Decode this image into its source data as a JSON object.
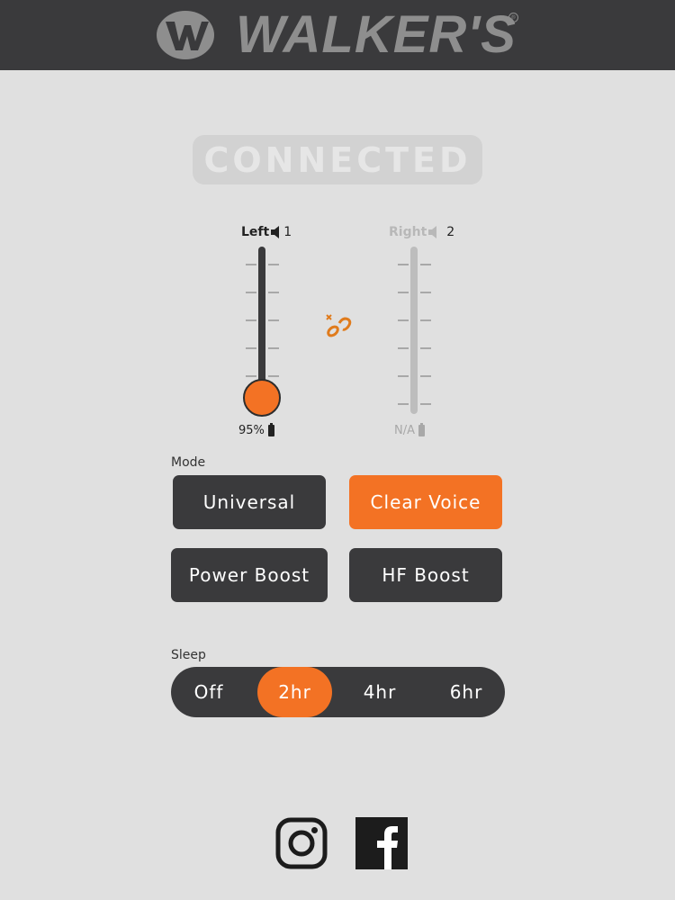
{
  "header": {
    "logo_text": "WALKER'S",
    "logo_mark_icon": "walkers-w-logo-icon",
    "registered_mark": "®"
  },
  "status": {
    "text": "CONNECTED"
  },
  "ears": {
    "left": {
      "label": "Left",
      "number": "1",
      "volume_level": 0,
      "battery": "95%",
      "speaker_icon": "speaker-icon",
      "battery_icon": "battery-icon"
    },
    "right": {
      "label": "Right",
      "number": "2",
      "battery": "N/A",
      "speaker_icon": "speaker-icon",
      "battery_icon": "battery-icon"
    },
    "link_icon": "link-chain-icon"
  },
  "mode": {
    "label": "Mode",
    "options": [
      "Universal",
      "Clear Voice",
      "Power Boost",
      "HF Boost"
    ],
    "selected": "Clear Voice"
  },
  "sleep": {
    "label": "Sleep",
    "options": [
      "Off",
      "2hr",
      "4hr",
      "6hr"
    ],
    "selected": "2hr"
  },
  "social": {
    "instagram_icon": "instagram-icon",
    "facebook_icon": "facebook-icon"
  },
  "colors": {
    "accent": "#f37224",
    "dark": "#3a3a3c",
    "background": "#e0e0e0"
  }
}
